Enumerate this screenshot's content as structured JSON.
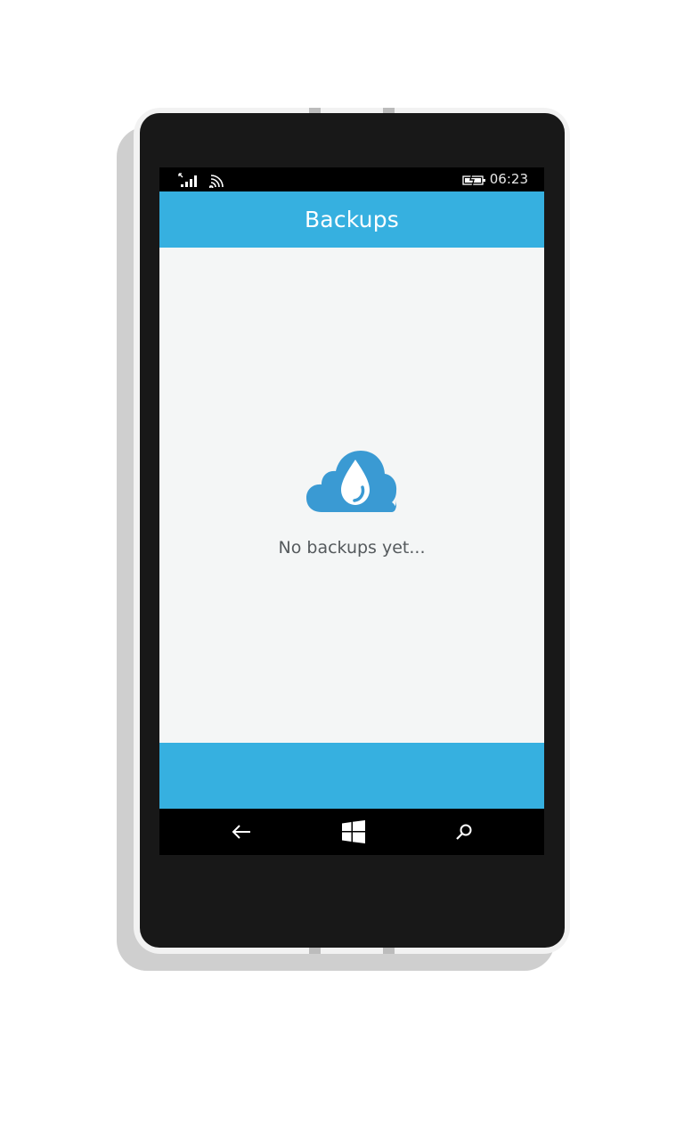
{
  "status_bar": {
    "time": "06:23",
    "icons": [
      "signal-icon",
      "wifi-icon",
      "battery-charging-icon"
    ]
  },
  "header": {
    "title": "Backups"
  },
  "empty_state": {
    "icon": "cloud-drop-icon",
    "message": "No backups yet..."
  },
  "navigation": {
    "buttons": [
      "back-arrow-icon",
      "windows-start-icon",
      "search-icon"
    ]
  },
  "colors": {
    "accent": "#36b0e0",
    "icon_blue": "#3a9ad3",
    "screen_bg": "#f4f6f6",
    "device_body": "#181818"
  }
}
